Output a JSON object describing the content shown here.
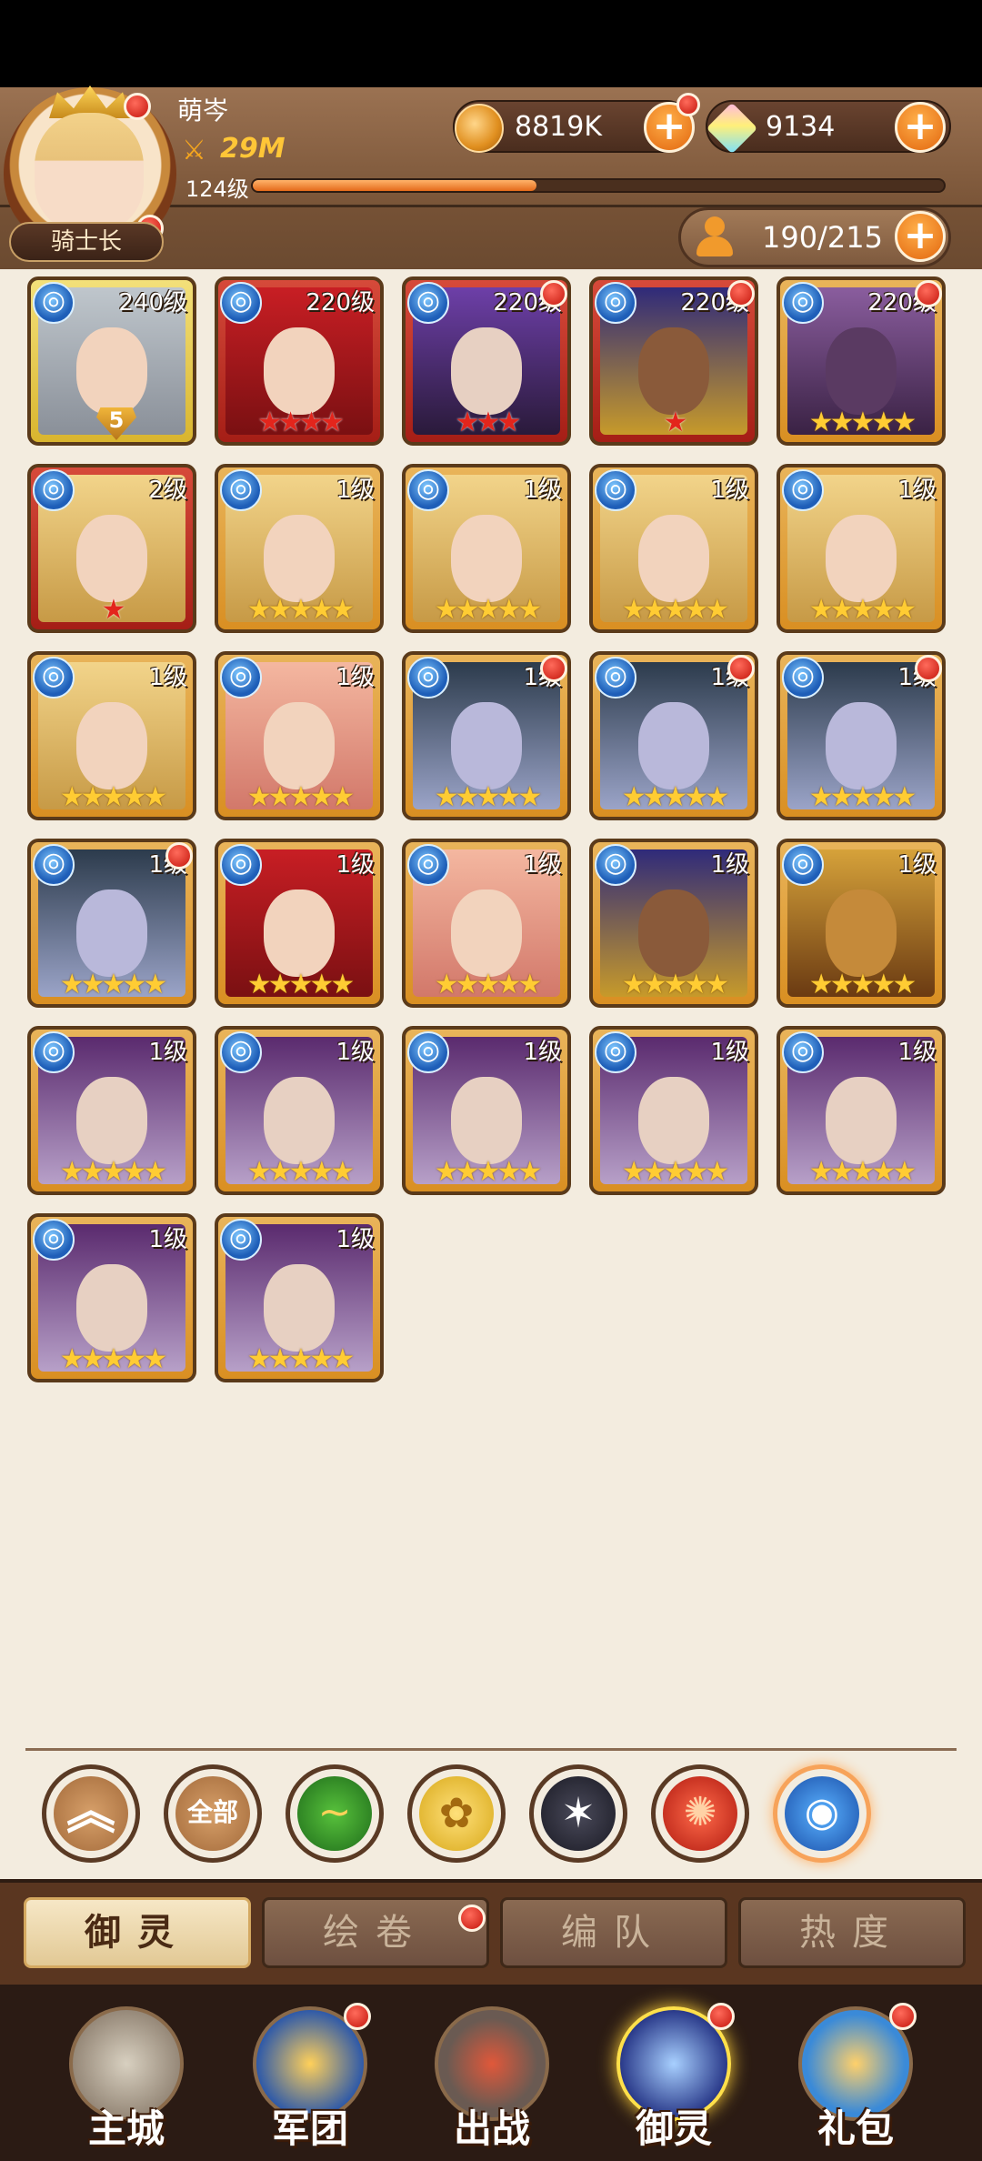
{
  "player": {
    "name": "萌岑",
    "power": "29M",
    "level": "124级",
    "xp_fraction": 0.41,
    "rank": "骑士长"
  },
  "resources": {
    "gold": "8819K",
    "gems": "9134",
    "roster": "190/215",
    "plus_symbol": "+"
  },
  "heroes": [
    {
      "level": "240级",
      "stars": "",
      "rank": "5",
      "frame": "yellow",
      "portrait": "silver",
      "dot": false
    },
    {
      "level": "220级",
      "stars": "★★★★",
      "star_color": "red",
      "frame": "red",
      "portrait": "crimson",
      "dot": false
    },
    {
      "level": "220级",
      "stars": "★★★",
      "star_color": "red",
      "frame": "red",
      "portrait": "dark",
      "dot": true
    },
    {
      "level": "220级",
      "stars": "★",
      "star_color": "red",
      "frame": "red",
      "portrait": "egypt",
      "dot": true
    },
    {
      "level": "220级",
      "stars": "★★★★★",
      "frame": "gold",
      "portrait": "demon",
      "dot": true
    },
    {
      "level": "2级",
      "stars": "★",
      "star_color": "red",
      "frame": "red",
      "portrait": "blonde",
      "dot": false
    },
    {
      "level": "1级",
      "stars": "★★★★★",
      "frame": "gold",
      "portrait": "blonde",
      "dot": false
    },
    {
      "level": "1级",
      "stars": "★★★★★",
      "frame": "gold",
      "portrait": "blonde",
      "dot": false
    },
    {
      "level": "1级",
      "stars": "★★★★★",
      "frame": "gold",
      "portrait": "blonde",
      "dot": false
    },
    {
      "level": "1级",
      "stars": "★★★★★",
      "frame": "gold",
      "portrait": "blonde",
      "dot": false
    },
    {
      "level": "1级",
      "stars": "★★★★★",
      "frame": "gold",
      "portrait": "blonde",
      "dot": false
    },
    {
      "level": "1级",
      "stars": "★★★★★",
      "frame": "gold",
      "portrait": "rose",
      "dot": false
    },
    {
      "level": "1级",
      "stars": "★★★★★",
      "frame": "gold",
      "portrait": "pale",
      "dot": true
    },
    {
      "level": "1级",
      "stars": "★★★★★",
      "frame": "gold",
      "portrait": "pale",
      "dot": true
    },
    {
      "level": "1级",
      "stars": "★★★★★",
      "frame": "gold",
      "portrait": "pale",
      "dot": true
    },
    {
      "level": "1级",
      "stars": "★★★★★",
      "frame": "gold",
      "portrait": "pale",
      "dot": true
    },
    {
      "level": "1级",
      "stars": "★★★★★",
      "frame": "gold",
      "portrait": "crimson",
      "dot": false
    },
    {
      "level": "1级",
      "stars": "★★★★★",
      "frame": "gold",
      "portrait": "rose",
      "dot": false
    },
    {
      "level": "1级",
      "stars": "★★★★★",
      "frame": "gold",
      "portrait": "egypt",
      "dot": false
    },
    {
      "level": "1级",
      "stars": "★★★★★",
      "frame": "gold",
      "portrait": "pharaoh",
      "dot": false
    },
    {
      "level": "1级",
      "stars": "★★★★★",
      "frame": "gold",
      "portrait": "vamp",
      "dot": false
    },
    {
      "level": "1级",
      "stars": "★★★★★",
      "frame": "gold",
      "portrait": "vamp",
      "dot": false
    },
    {
      "level": "1级",
      "stars": "★★★★★",
      "frame": "gold",
      "portrait": "vamp",
      "dot": false
    },
    {
      "level": "1级",
      "stars": "★★★★★",
      "frame": "gold",
      "portrait": "vamp",
      "dot": false
    },
    {
      "level": "1级",
      "stars": "★★★★★",
      "frame": "gold",
      "portrait": "vamp",
      "dot": false
    },
    {
      "level": "1级",
      "stars": "★★★★★",
      "frame": "gold",
      "portrait": "vamp",
      "dot": false
    },
    {
      "level": "1级",
      "stars": "★★★★★",
      "frame": "gold",
      "portrait": "vamp",
      "dot": false
    }
  ],
  "filters": {
    "up_icon": "︽",
    "all_label": "全部",
    "items": [
      "chevron-up-icon",
      "all",
      "nature-faction-icon",
      "light-faction-icon",
      "dark-faction-icon",
      "fire-faction-icon",
      "water-faction-icon"
    ],
    "selected": "water-faction-icon"
  },
  "subtabs": [
    {
      "label": "御灵",
      "active": true,
      "dot": false
    },
    {
      "label": "绘卷",
      "active": false,
      "dot": true
    },
    {
      "label": "编队",
      "active": false,
      "dot": false
    },
    {
      "label": "热度",
      "active": false,
      "dot": false
    }
  ],
  "bottom_nav": [
    {
      "label": "主城",
      "icon": "castle-icon",
      "active": false,
      "dot": false
    },
    {
      "label": "军团",
      "icon": "legion-fist-icon",
      "active": false,
      "dot": true
    },
    {
      "label": "出战",
      "icon": "battle-gate-icon",
      "active": false,
      "dot": false
    },
    {
      "label": "御灵",
      "icon": "spirit-crystal-icon",
      "active": true,
      "dot": true
    },
    {
      "label": "礼包",
      "icon": "gift-shop-icon",
      "active": false,
      "dot": true
    }
  ],
  "colors": {
    "accent_orange": "#e2660e",
    "gold_text": "#ffc637",
    "brown_header": "#7a5538",
    "notification_red": "#c4160c"
  }
}
